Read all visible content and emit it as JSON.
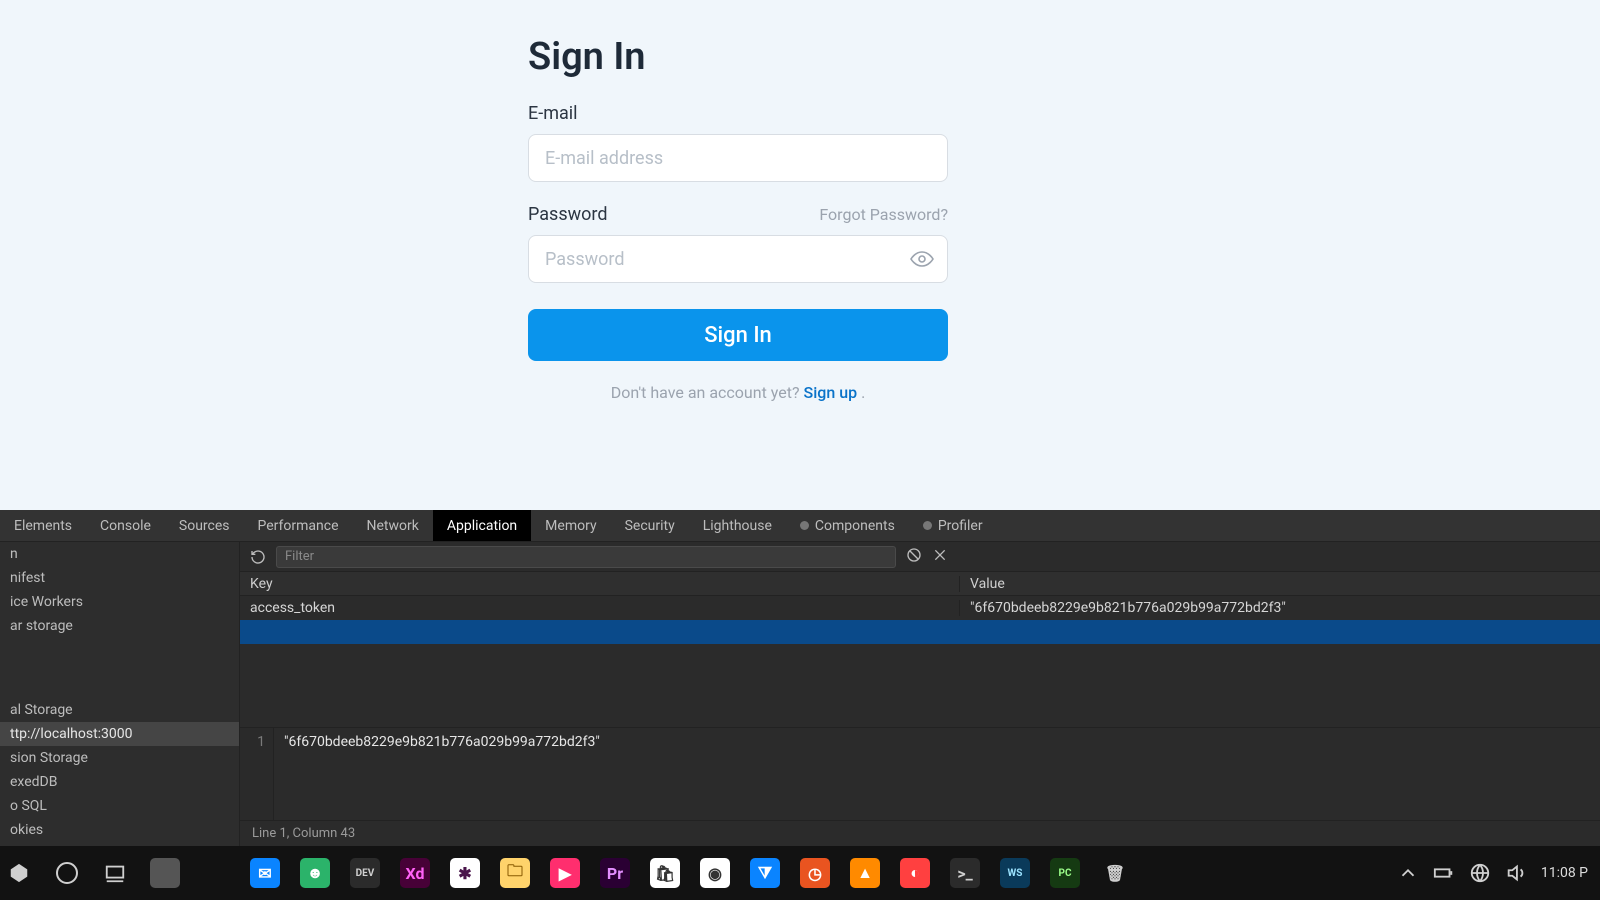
{
  "signin": {
    "title": "Sign In",
    "email_label": "E-mail",
    "email_placeholder": "E-mail address",
    "password_label": "Password",
    "password_placeholder": "Password",
    "forgot": "Forgot Password?",
    "submit": "Sign In",
    "no_account": "Don't have an account yet? ",
    "signup": "Sign up",
    "period": " ."
  },
  "devtools": {
    "tabs": [
      "Elements",
      "Console",
      "Sources",
      "Performance",
      "Network",
      "Application",
      "Memory",
      "Security",
      "Lighthouse",
      "Components",
      "Profiler"
    ],
    "active_tab": "Application",
    "sidebar": {
      "items_top": [
        "n",
        "nifest",
        "ice Workers",
        "ar storage"
      ],
      "items_storage": [
        "al Storage",
        "ttp://localhost:3000",
        "sion Storage",
        "exedDB",
        "o SQL",
        "okies"
      ],
      "selected": "ttp://localhost:3000"
    },
    "filter_placeholder": "Filter",
    "table": {
      "headers": {
        "key": "Key",
        "value": "Value"
      },
      "rows": [
        {
          "key": "access_token",
          "value": "\"6f670bdeeb8229e9b821b776a029b99a772bd2f3\""
        }
      ]
    },
    "editor": {
      "line_no": "1",
      "code": "\"6f670bdeeb8229e9b821b776a029b99a772bd2f3\""
    },
    "status": "Line 1, Column 43"
  },
  "taskbar": {
    "apps": [
      {
        "name": "cortana-icon",
        "bg": "#555",
        "fg": "#fff",
        "txt": ""
      },
      {
        "name": "taskview-icon",
        "bg": "transparent",
        "fg": "#cfcfcf",
        "txt": ""
      },
      {
        "name": "mail-icon",
        "bg": "#0a84ff",
        "fg": "#fff",
        "txt": "✉"
      },
      {
        "name": "app-green-icon",
        "bg": "#2bb36a",
        "fg": "#fff",
        "txt": "☻"
      },
      {
        "name": "dev-icon",
        "bg": "#2b2b2b",
        "fg": "#cfcfcf",
        "txt": "DEV"
      },
      {
        "name": "xd-icon",
        "bg": "#470137",
        "fg": "#ff61f6",
        "txt": "Xd"
      },
      {
        "name": "slack-icon",
        "bg": "#fff",
        "fg": "#4a154b",
        "txt": "✱"
      },
      {
        "name": "explorer-icon",
        "bg": "#ffd36b",
        "fg": "#8a5a00",
        "txt": "🗀"
      },
      {
        "name": "music-icon",
        "bg": "#ff2e6e",
        "fg": "#fff",
        "txt": "▶"
      },
      {
        "name": "premiere-icon",
        "bg": "#2a0033",
        "fg": "#e38fff",
        "txt": "Pr"
      },
      {
        "name": "store-icon",
        "bg": "#fff",
        "fg": "#333",
        "txt": "🛍"
      },
      {
        "name": "chrome-icon",
        "bg": "#fff",
        "fg": "#333",
        "txt": "◉"
      },
      {
        "name": "vscode-icon",
        "bg": "#0a84ff",
        "fg": "#fff",
        "txt": "⧩"
      },
      {
        "name": "ubuntu-icon",
        "bg": "#e95420",
        "fg": "#fff",
        "txt": "◷"
      },
      {
        "name": "vlc-icon",
        "bg": "#ff8a00",
        "fg": "#fff",
        "txt": "▲"
      },
      {
        "name": "app-red-icon",
        "bg": "#ff4040",
        "fg": "#fff",
        "txt": "◐"
      },
      {
        "name": "terminal-icon",
        "bg": "#2b2b2b",
        "fg": "#cfcfcf",
        "txt": ">_"
      },
      {
        "name": "webstorm-icon",
        "bg": "#0a3a5a",
        "fg": "#9be3ff",
        "txt": "WS"
      },
      {
        "name": "pycharm-icon",
        "bg": "#153a12",
        "fg": "#9cff8a",
        "txt": "PC"
      },
      {
        "name": "trash-icon",
        "bg": "transparent",
        "fg": "#cfcfcf",
        "txt": "🗑"
      }
    ],
    "clock": "11:08 P"
  }
}
